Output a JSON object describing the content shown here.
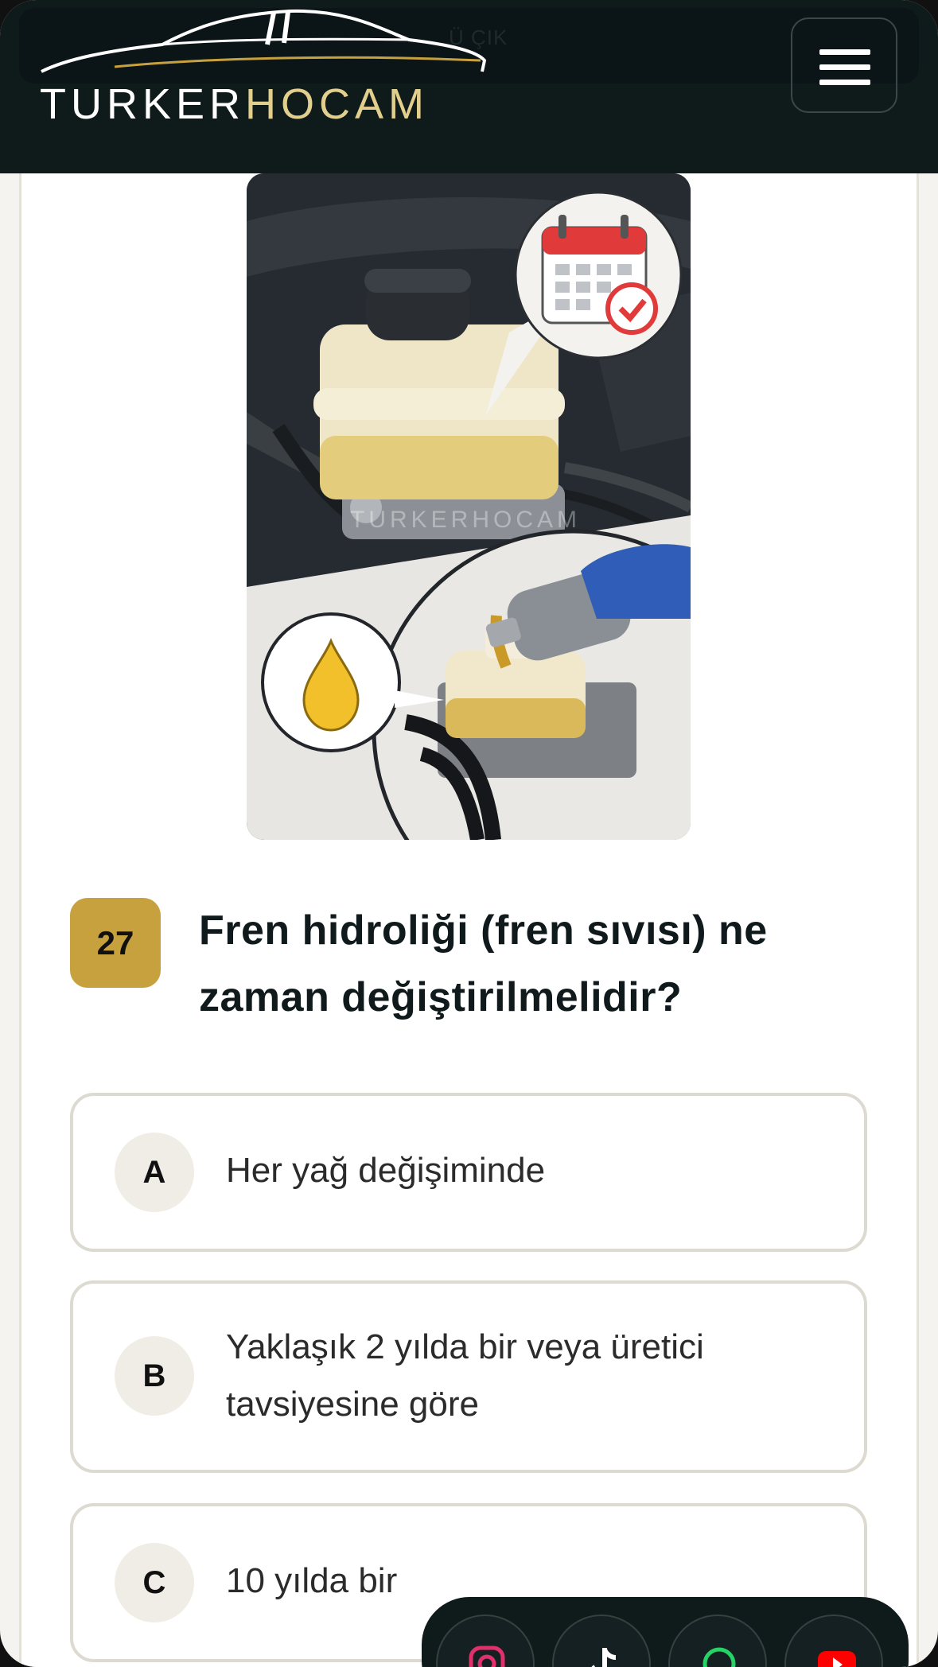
{
  "header": {
    "ghost_text": "Ü ÇIK",
    "logo": {
      "part1": "TURKER",
      "part2": "HOCAM"
    }
  },
  "illustration": {
    "watermark": "TURKERHOCAM"
  },
  "question": {
    "number": "27",
    "text": "Fren hidroliği (fren sıvısı) ne zaman değiştirilmelidir?"
  },
  "options": [
    {
      "letter": "A",
      "text": "Her yağ değişiminde"
    },
    {
      "letter": "B",
      "text": "Yaklaşık 2 yılda bir veya üretici tavsiyesine göre"
    },
    {
      "letter": "C",
      "text": "10 yılda bir"
    }
  ],
  "social": [
    "instagram-icon",
    "tiktok-icon",
    "whatsapp-icon",
    "youtube-icon"
  ],
  "colors": {
    "header_bg": "#0f1a1b",
    "accent_gold": "#c8a13f",
    "logo_gold": "#e2cf8e"
  }
}
